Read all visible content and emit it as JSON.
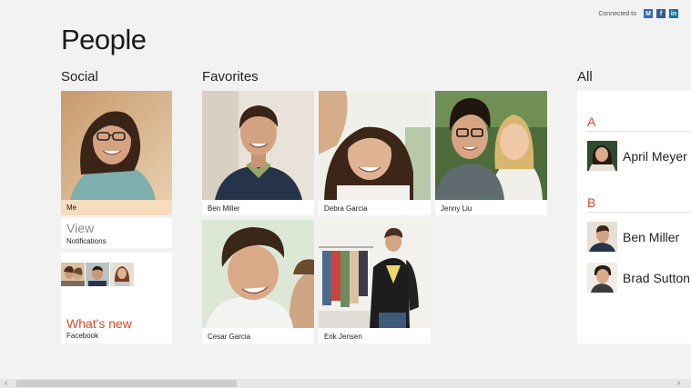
{
  "header": {
    "connected_label": "Connected to",
    "services": [
      {
        "name": "windows-live-icon",
        "glyph": "M"
      },
      {
        "name": "facebook-icon",
        "glyph": "f"
      },
      {
        "name": "linkedin-icon",
        "glyph": "in"
      }
    ]
  },
  "page": {
    "title": "People"
  },
  "sections": {
    "social": "Social",
    "favorites": "Favorites",
    "all": "All"
  },
  "social": {
    "me_label": "Me",
    "view_label": "View",
    "notifications_label": "Notifications",
    "whats_new_label": "What's new",
    "facebook_label": "Facebook"
  },
  "favorites": [
    {
      "name": "Ben Miller"
    },
    {
      "name": "Debra Garcia"
    },
    {
      "name": "Jenny Liu"
    },
    {
      "name": "Cesar Garcia"
    },
    {
      "name": "Erik Jensen"
    }
  ],
  "all": {
    "groups": [
      {
        "letter": "A",
        "contacts": [
          "April Meyer"
        ]
      },
      {
        "letter": "B",
        "contacts": [
          "Ben Miller",
          "Brad Sutton"
        ]
      }
    ]
  },
  "colors": {
    "accent": "#d14b2a",
    "me_caption": "#f7dcbd",
    "background": "#f2f2f2"
  }
}
